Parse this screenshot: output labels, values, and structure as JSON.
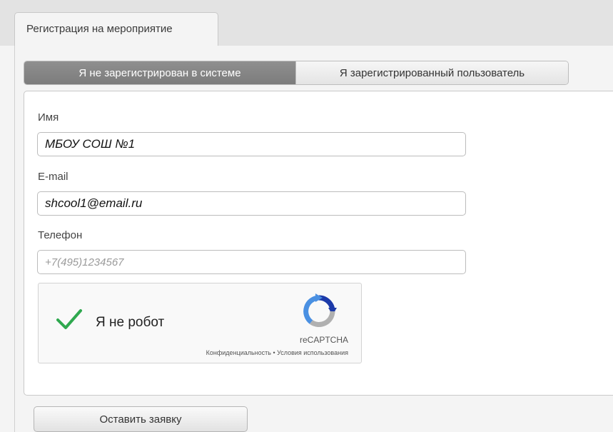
{
  "tabs": {
    "active_label": "Регистрация на мероприятие"
  },
  "segmented": {
    "options": [
      {
        "label": "Я не зарегистрирован в системе",
        "selected": true
      },
      {
        "label": "Я зарегистрированный пользователь",
        "selected": false
      }
    ]
  },
  "form": {
    "name": {
      "label": "Имя",
      "value": "МБОУ СОШ №1",
      "placeholder": ""
    },
    "email": {
      "label": "E-mail",
      "value": "shcool1@email.ru",
      "placeholder": ""
    },
    "phone": {
      "label": "Телефон",
      "value": "",
      "placeholder": "+7(495)1234567"
    }
  },
  "captcha": {
    "label": "Я не робот",
    "checked": true,
    "brand": "reCAPTCHA",
    "links": "Конфиденциальность • Условия использования",
    "check_icon": "checkmark-icon",
    "logo_icon": "recaptcha-logo-icon"
  },
  "submit": {
    "label": "Оставить заявку"
  },
  "colors": {
    "active_segment": "#858585",
    "check_green": "#2fa84f",
    "recaptcha_blue": "#1c3aa9",
    "recaptcha_light_blue": "#4a90e2",
    "recaptcha_gray": "#b0b0b0"
  }
}
